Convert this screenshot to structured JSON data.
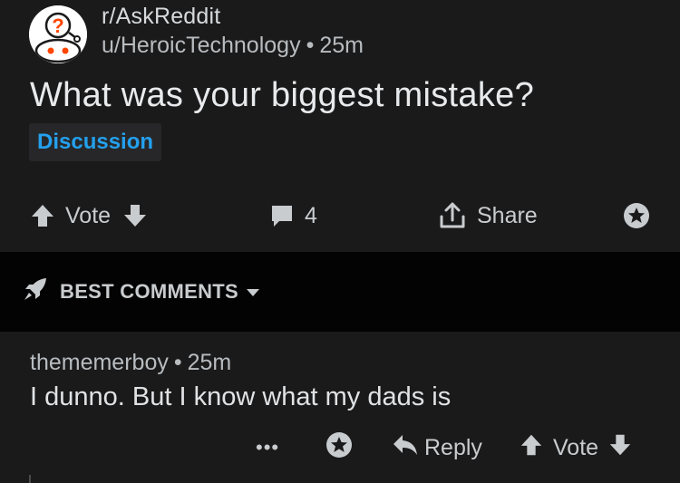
{
  "post": {
    "subreddit": "r/AskReddit",
    "author": "u/HeroicTechnology",
    "separator": "•",
    "age": "25m",
    "title": "What was your biggest mistake?",
    "flair": "Discussion",
    "vote_label": "Vote",
    "comment_count": "4",
    "share_label": "Share"
  },
  "sort": {
    "label": "BEST COMMENTS"
  },
  "comment": {
    "author": "thememerboy",
    "separator": "•",
    "age": "25m",
    "body": "I dunno. But I know what my dads is",
    "more_label": "•••",
    "reply_label": "Reply",
    "vote_label": "Vote"
  },
  "colors": {
    "background": "#1a1a1b",
    "band": "#030303",
    "flair_text": "#24a0ed",
    "text": "#d7dadc"
  },
  "icons": [
    "subreddit-avatar-icon",
    "upvote-icon",
    "downvote-icon",
    "comment-icon",
    "share-icon",
    "award-icon",
    "rocket-icon",
    "chevron-down-icon",
    "reply-icon",
    "more-icon"
  ]
}
